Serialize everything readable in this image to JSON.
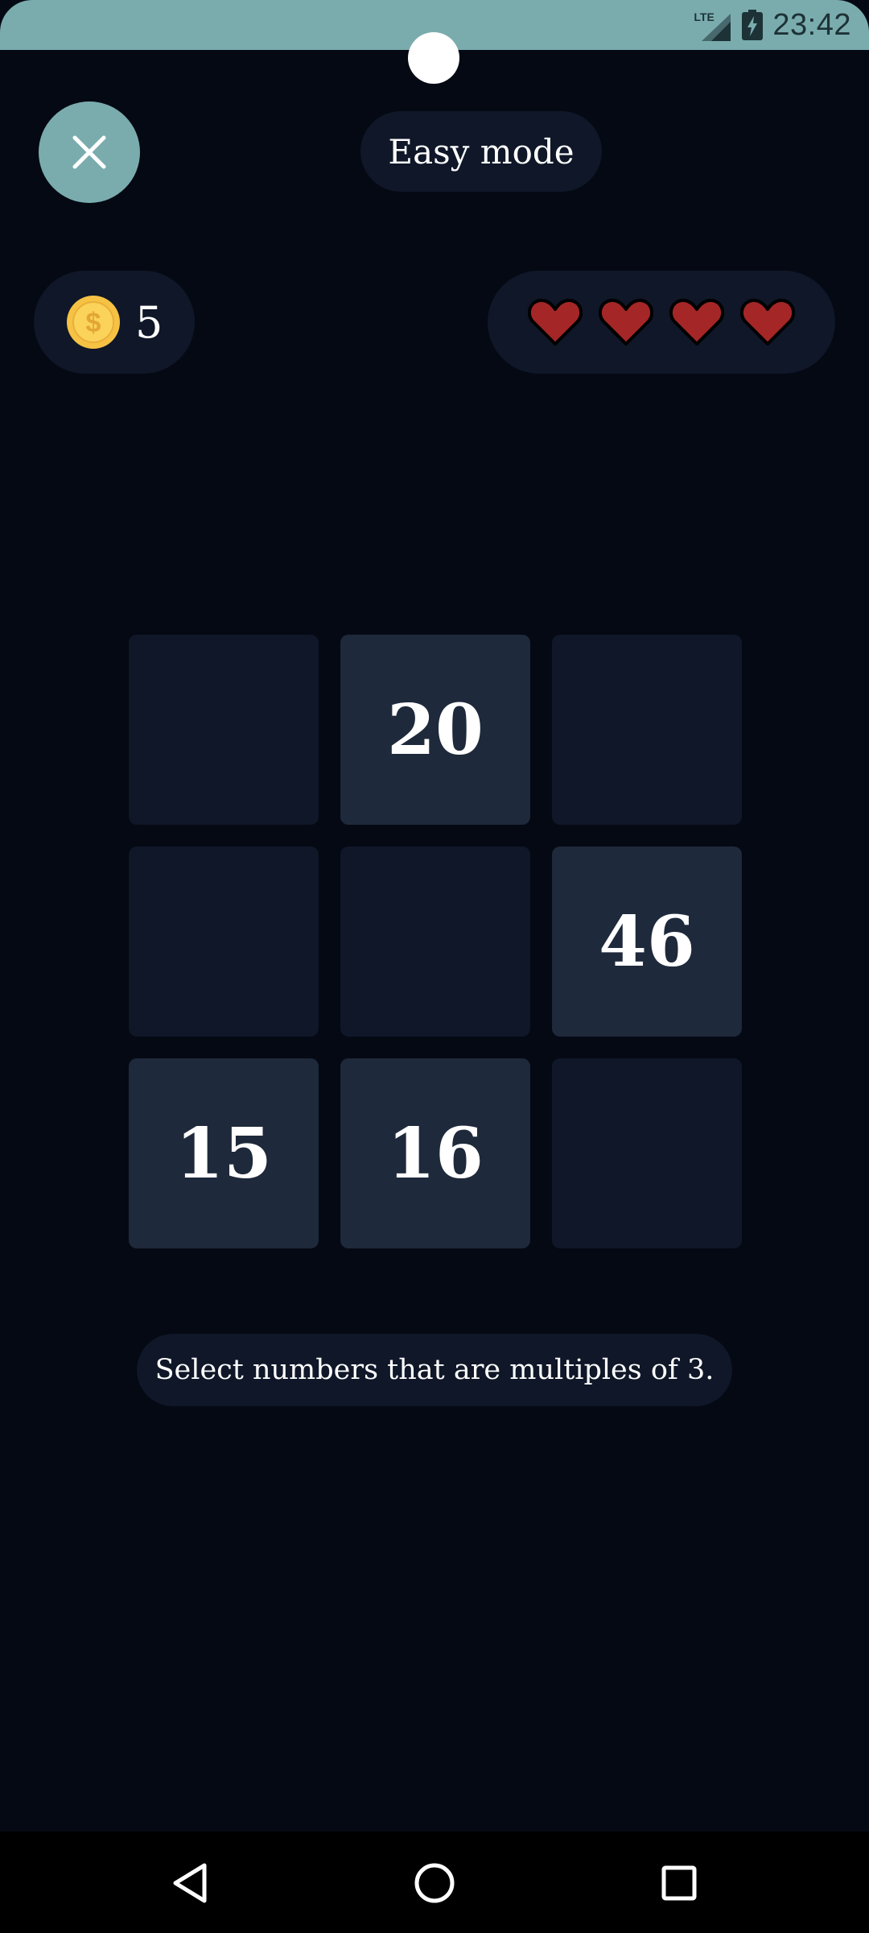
{
  "status_bar": {
    "network": "LTE",
    "time": "23:42"
  },
  "header": {
    "close_icon": "close-icon",
    "mode_label": "Easy mode"
  },
  "stats": {
    "coin_icon": "coin-icon",
    "coins": "5",
    "lives_icon": "heart-icon",
    "lives_remaining": 4,
    "lives_total": 4
  },
  "board": {
    "tiles": [
      "",
      "20",
      "",
      "",
      "",
      "46",
      "15",
      "16",
      ""
    ]
  },
  "instruction": "Select numbers that are multiples of 3.",
  "nav": {
    "back_icon": "back-triangle-icon",
    "home_icon": "home-circle-icon",
    "recents_icon": "recents-square-icon"
  },
  "colors": {
    "accent": "#7aacae",
    "background": "#050914",
    "pill": "#0f1728",
    "tile_filled": "#1e293b",
    "heart": "#a52626",
    "coin": "#f6c244"
  }
}
